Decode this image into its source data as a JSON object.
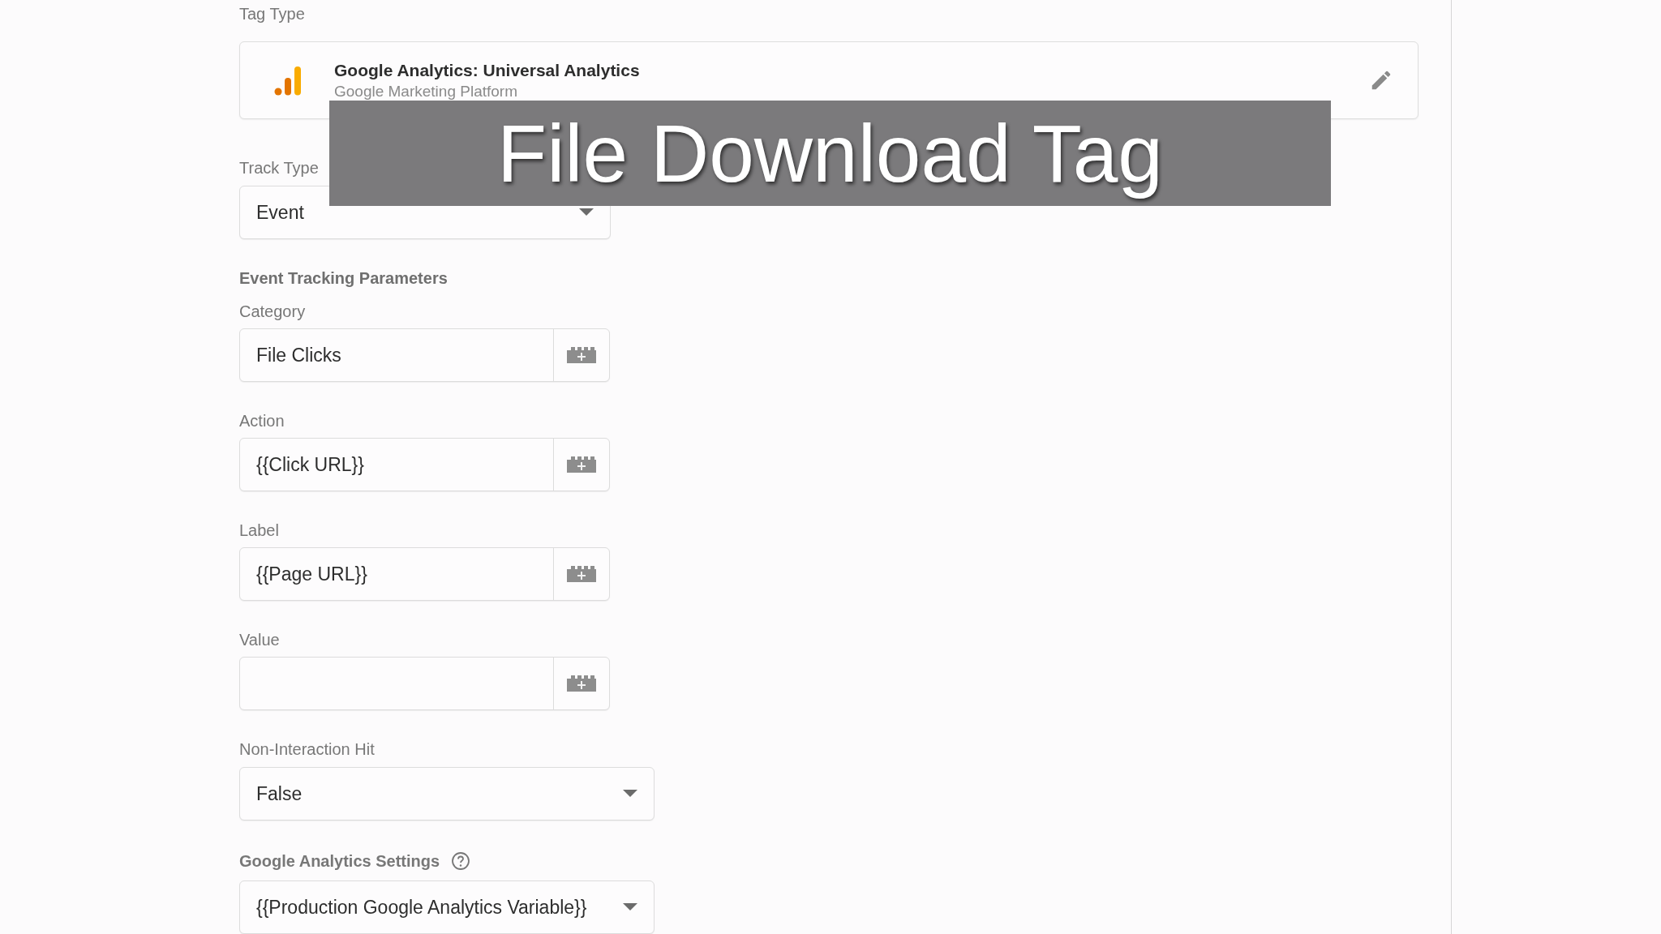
{
  "tag_type": {
    "label": "Tag Type",
    "title": "Google Analytics: Universal Analytics",
    "subtitle": "Google Marketing Platform"
  },
  "track_type": {
    "label": "Track Type",
    "value": "Event"
  },
  "section_title": "Event Tracking Parameters",
  "fields": [
    {
      "label": "Category",
      "value": "File Clicks"
    },
    {
      "label": "Action",
      "value": "{{Click URL}}"
    },
    {
      "label": "Label",
      "value": "{{Page URL}}"
    },
    {
      "label": "Value"
    }
  ],
  "non_interaction": {
    "label": "Non-Interaction Hit",
    "value": "False"
  },
  "ga_settings": {
    "label": "Google Analytics Settings",
    "value": "{{Production Google Analytics Variable}}"
  },
  "caption": "File Download Tag"
}
